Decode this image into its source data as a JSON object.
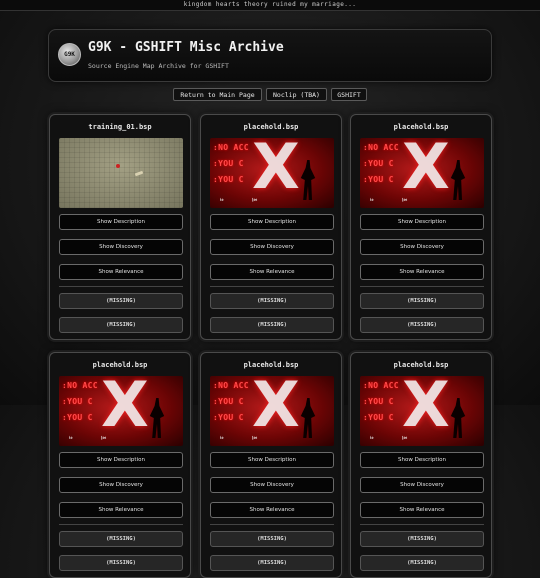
{
  "marquee": "kingdom hearts theory ruined my marriage...",
  "header": {
    "logo_text": "G9K",
    "title": "G9K - GSHIFT Misc Archive",
    "subtitle": "Source Engine Map Archive for GSHIFT"
  },
  "nav": {
    "main": "Return to Main Page",
    "noclip": "Noclip (TBA)",
    "gshift": "GSHIFT"
  },
  "buttons": {
    "description": "Show Description",
    "discovery": "Show Discovery",
    "relevance": "Show Relevance",
    "missing": "(MISSING)"
  },
  "poster": {
    "line1": ":NO ACC",
    "line2": ":YOU C",
    "line3": ":YOU C",
    "logo_a": "𝖎𝖔",
    "logo_b": "𝖏𝖔𝖊"
  },
  "cards": [
    {
      "title": "training_01.bsp",
      "image": "map"
    },
    {
      "title": "placehold.bsp",
      "image": "poster"
    },
    {
      "title": "placehold.bsp",
      "image": "poster"
    },
    {
      "title": "placehold.bsp",
      "image": "poster"
    },
    {
      "title": "placehold.bsp",
      "image": "poster"
    },
    {
      "title": "placehold.bsp",
      "image": "poster"
    }
  ]
}
